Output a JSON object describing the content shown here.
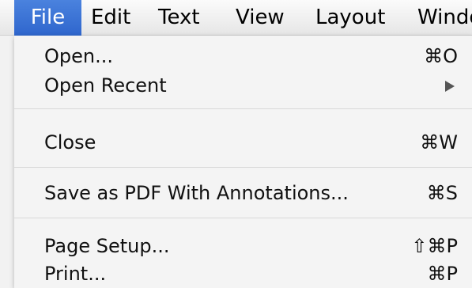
{
  "menubar": {
    "items": [
      "File",
      "Edit",
      "Text",
      "View",
      "Layout",
      "Windo"
    ],
    "active_index": 0,
    "active_color": "#3a72d6"
  },
  "file_menu": {
    "items": [
      {
        "label": "Open...",
        "shortcut": "⌘O"
      },
      {
        "label": "Open Recent",
        "submenu_icon": "submenu-arrow-icon"
      },
      {
        "label": "Close",
        "shortcut": "⌘W"
      },
      {
        "label": "Save as PDF With Annotations...",
        "shortcut": "⌘S"
      },
      {
        "label": "Page Setup...",
        "shortcut": "⇧⌘P"
      },
      {
        "label": "Print...",
        "shortcut": "⌘P"
      }
    ]
  }
}
